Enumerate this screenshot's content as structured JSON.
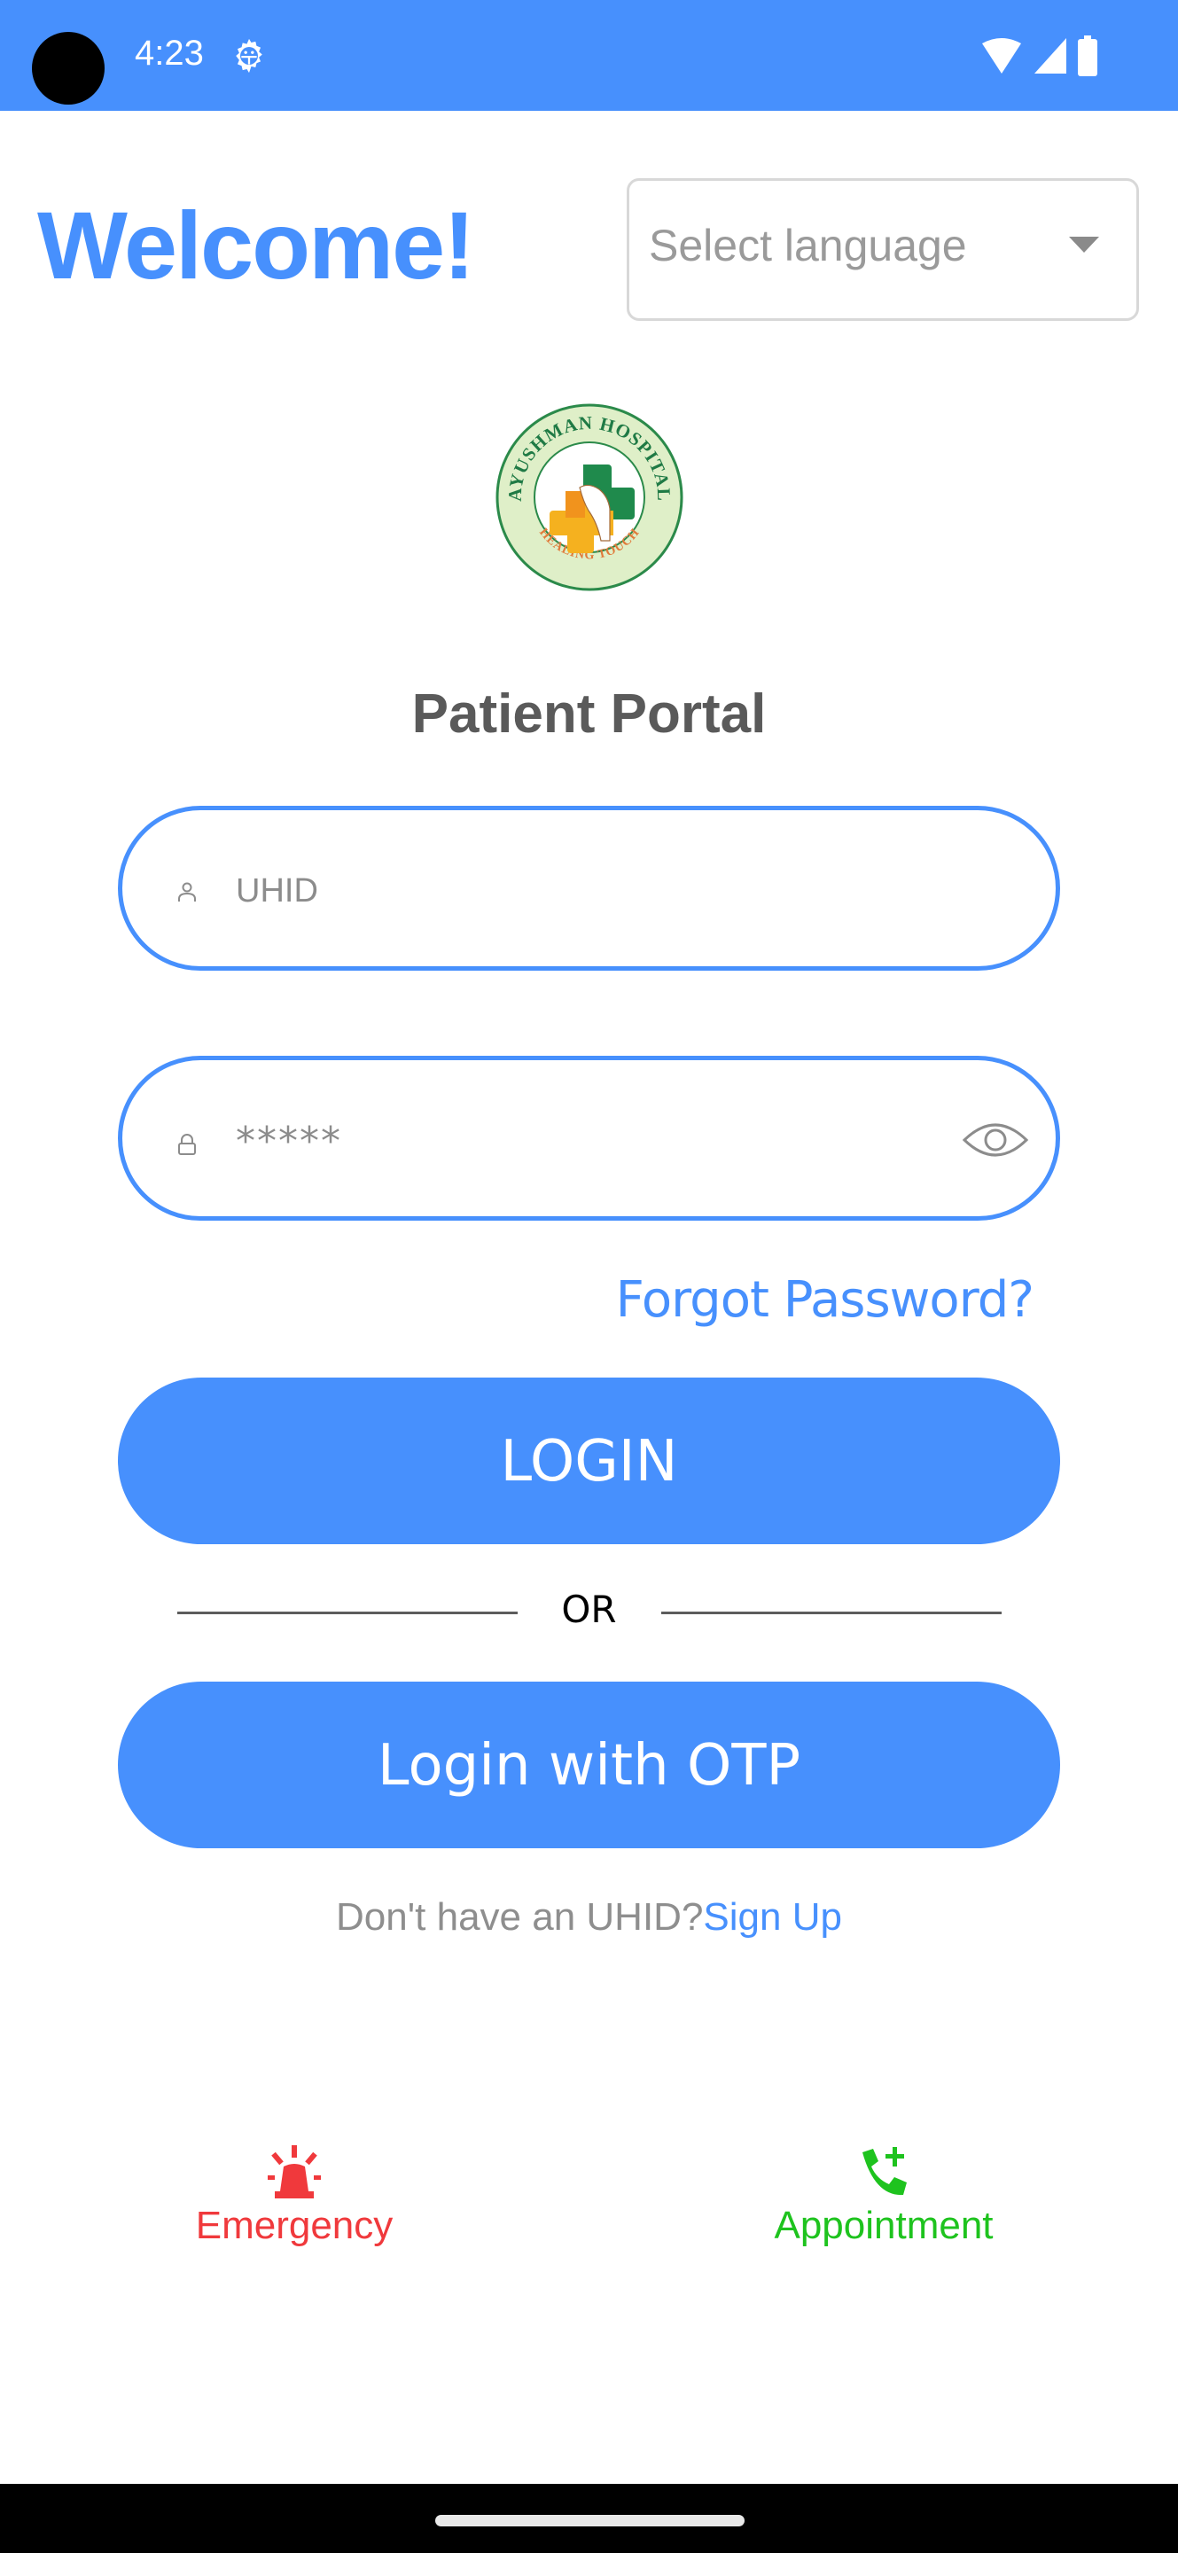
{
  "status_bar": {
    "time": "4:23",
    "icons": [
      "camera-cutout",
      "settings-gear-icon",
      "wifi-icon",
      "cellular-signal-icon",
      "battery-icon"
    ]
  },
  "header": {
    "welcome": "Welcome!",
    "language_select": {
      "placeholder": "Select language",
      "selected": ""
    }
  },
  "logo": {
    "top_text": "AYUSHMAN HOSPITAL",
    "bottom_text": "HEALING TOUCH",
    "colors": {
      "green": "#1f8a4c",
      "ring": "#dfefc8",
      "orange": "#f0a020"
    }
  },
  "form": {
    "title": "Patient Portal",
    "uhid": {
      "placeholder": "UHID",
      "value": "",
      "icon": "person-icon"
    },
    "password": {
      "placeholder": "*****",
      "value": "",
      "icon": "lock-icon",
      "toggle_icon": "eye-icon"
    },
    "forgot_password": "Forgot Password?",
    "login_button": "LOGIN",
    "divider": "OR",
    "otp_button": "Login with OTP",
    "signup_prompt": "Don't have an UHID?",
    "signup_link": "Sign Up"
  },
  "quick_actions": [
    {
      "label": "Emergency",
      "icon": "siren-icon",
      "color": "#f0393c"
    },
    {
      "label": "Appointment",
      "icon": "phone-add-icon",
      "color": "#1ec31e"
    }
  ],
  "theme": {
    "primary": "#4790fd",
    "text_gray": "#8e8e8e",
    "title_gray": "#5a5a5a"
  }
}
